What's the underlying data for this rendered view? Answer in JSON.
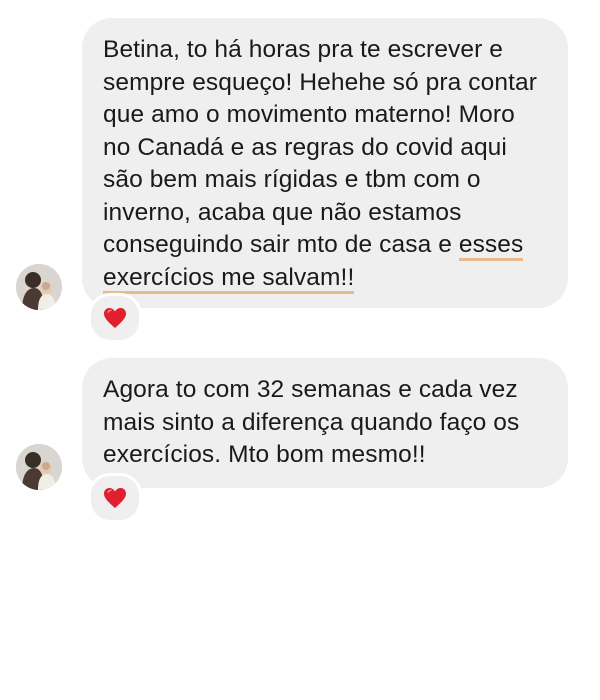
{
  "conversation": {
    "messages": [
      {
        "text_before": "Betina, to há horas pra te escrever e sempre esqueço! Hehehe só pra contar que amo o movimento materno! Moro no Canadá e as regras do covid aqui são bem mais rígidas e tbm com o inverno, acaba que não estamos conseguindo sair mto de casa e ",
        "highlighted": "esses exercícios me salvam!!",
        "reaction": "heart",
        "highlight_color": "#e7bc8a"
      },
      {
        "text": "Agora to com 32 semanas e cada vez mais sinto a diferença quando faço os exercícios. Mto bom mesmo!!",
        "reaction": "heart"
      }
    ],
    "colors": {
      "bubble": "#efefef",
      "text": "#1a1a1a",
      "heart": "#e0202e"
    }
  }
}
